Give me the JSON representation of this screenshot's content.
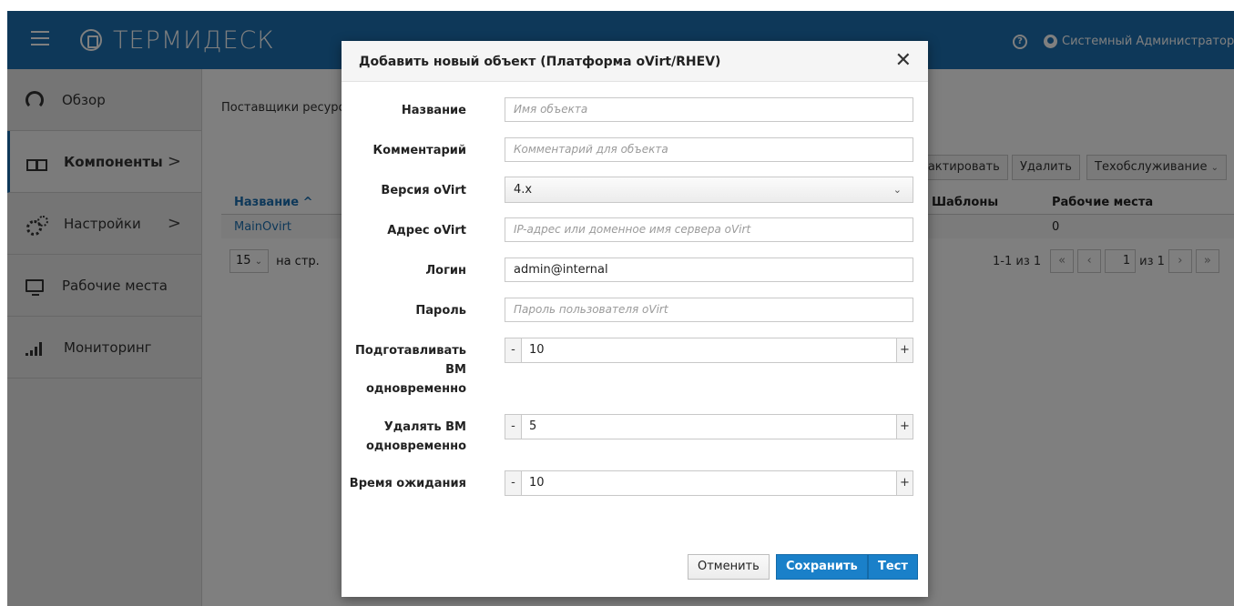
{
  "app": {
    "logo_text": "ТЕРМИДЕСК",
    "user_name": "Системный Администратор"
  },
  "sidebar": {
    "items": [
      {
        "label": "Обзор"
      },
      {
        "label": "Компоненты"
      },
      {
        "label": "Настройки"
      },
      {
        "label": "Рабочие места"
      },
      {
        "label": "Мониторинг"
      }
    ]
  },
  "main": {
    "breadcrumb": "Поставщики ресурсов",
    "toolbar": {
      "edit": "Редактировать",
      "delete": "Удалить",
      "maintenance": "Техобслуживание"
    },
    "table": {
      "col_name": "Название ^",
      "col_templates": "Шаблоны",
      "col_workplaces": "Рабочие места",
      "row_name": "MainOvirt",
      "row_workplaces": "0"
    },
    "pager": {
      "per_page_value": "15",
      "per_page_label": "на стр.",
      "range": "1-1 из 1",
      "page": "1",
      "of": "из 1"
    }
  },
  "modal": {
    "title": "Добавить новый объект (Платформа oVirt/RHEV)",
    "fields": {
      "name": {
        "label": "Название",
        "placeholder": "Имя объекта",
        "value": ""
      },
      "comment": {
        "label": "Комментарий",
        "placeholder": "Комментарий для объекта",
        "value": ""
      },
      "version": {
        "label": "Версия oVirt",
        "value": "4.x"
      },
      "address": {
        "label": "Адрес oVirt",
        "placeholder": "IP-адрес или доменное имя сервера oVirt",
        "value": ""
      },
      "login": {
        "label": "Логин",
        "value": "admin@internal"
      },
      "password": {
        "label": "Пароль",
        "placeholder": "Пароль пользователя oVirt",
        "value": ""
      },
      "prepare_vm": {
        "label_1": "Подготавливать",
        "label_2": "ВМ",
        "label_3": "одновременно",
        "value": "10"
      },
      "delete_vm": {
        "label_1": "Удалять ВМ",
        "label_2": "одновременно",
        "value": "5"
      },
      "timeout": {
        "label": "Время ожидания",
        "value": "10"
      }
    },
    "buttons": {
      "cancel": "Отменить",
      "save": "Сохранить",
      "test": "Тест"
    }
  }
}
